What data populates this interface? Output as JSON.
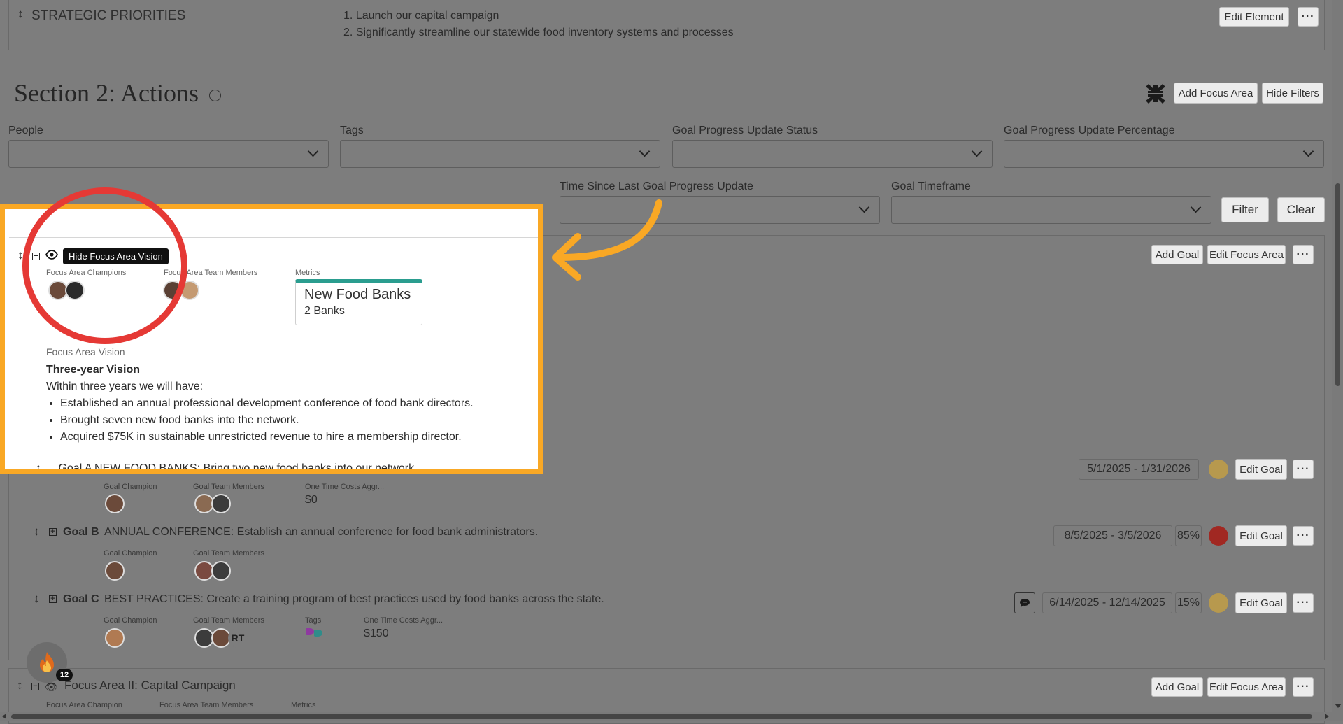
{
  "strategic": {
    "title": "STRATEGIC PRIORITIES",
    "item1": "1. Launch our capital campaign",
    "item2": "2. Significantly streamline our statewide food inventory systems and processes",
    "edit_label": "Edit Element",
    "more": "···"
  },
  "section": {
    "title": "Section 2: Actions",
    "add_focus_area": "Add Focus Area",
    "hide_filters": "Hide Filters"
  },
  "filters": {
    "people": "People",
    "tags": "Tags",
    "status": "Goal Progress Update Status",
    "percentage": "Goal Progress Update Percentage",
    "time_since": "Time Since Last Goal Progress Update",
    "timeframe": "Goal Timeframe",
    "filter_btn": "Filter",
    "clear_btn": "Clear"
  },
  "focus1": {
    "tooltip": "Hide Focus Area Vision",
    "champions_label": "Focus Area Champions",
    "team_label": "Focus Area Team Members",
    "metrics_label": "Metrics",
    "metric_title": "New Food Banks",
    "metric_value": "2 Banks",
    "vision_label": "Focus Area Vision",
    "vision_heading": "Three-year Vision",
    "vision_intro": "Within three years we will have:",
    "vision_items": [
      "Established an annual professional development conference of food bank directors.",
      "Brought seven new food banks into the network.",
      "Acquired $75K in sustainable unrestricted revenue to hire a membership director."
    ],
    "add_goal": "Add Goal",
    "edit_focus": "Edit Focus Area",
    "partial_goal": "Goal A  NEW FOOD BANKS: Bring two new food banks into our network"
  },
  "goals": [
    {
      "label": "Goal A",
      "dates": "5/1/2025 - 1/31/2026",
      "percent": "",
      "status_color": "#b7994e",
      "champion_label": "Goal Champion",
      "team_label": "Goal Team Members",
      "cost_label": "One Time Costs Aggr...",
      "cost": "$0",
      "edit": "Edit Goal"
    },
    {
      "label": "Goal B",
      "text": "ANNUAL CONFERENCE: Establish an annual conference for food bank administrators.",
      "dates": "8/5/2025 - 3/5/2026",
      "percent": "85%",
      "status_color": "#a12822",
      "champion_label": "Goal Champion",
      "team_label": "Goal Team Members",
      "edit": "Edit Goal"
    },
    {
      "label": "Goal C",
      "text": "BEST PRACTICES: Create a training program of best practices used by food banks across the state.",
      "dates": "6/14/2025 - 12/14/2025",
      "percent": "15%",
      "status_color": "#b7994e",
      "champion_label": "Goal Champion",
      "team_label": "Goal Team Members",
      "tags_label": "Tags",
      "cost_label": "One Time Costs Aggr...",
      "cost": "$150",
      "initials": "RT",
      "edit": "Edit Goal"
    }
  ],
  "focus2": {
    "title": "Focus Area II: Capital Campaign",
    "champion_label": "Focus Area Champion",
    "team_label": "Focus Area Team Members",
    "metrics_label": "Metrics",
    "add_goal": "Add Goal",
    "edit_focus": "Edit Focus Area"
  },
  "badge": {
    "count": "12"
  },
  "colors": {
    "highlight": "#f9a825",
    "annotation_red": "#e53935",
    "accent_teal": "#2a9d8f"
  }
}
